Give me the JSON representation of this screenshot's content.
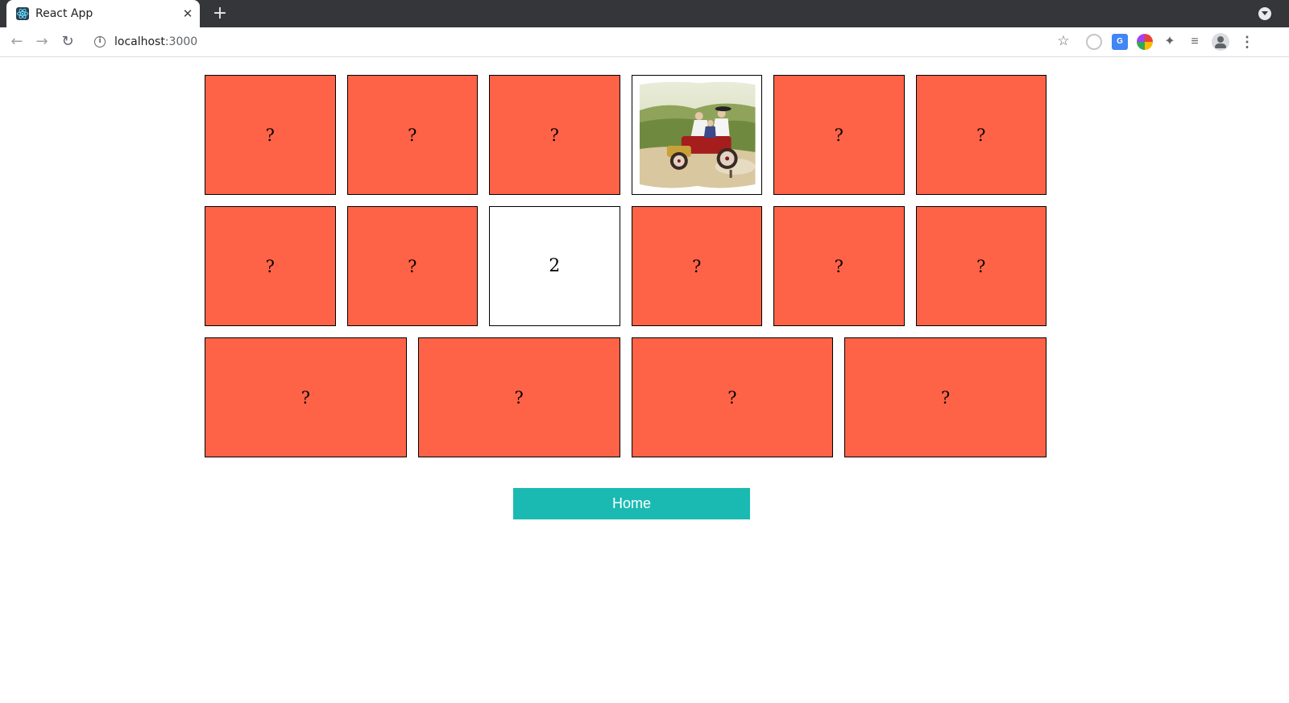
{
  "browser": {
    "tab_title": "React App",
    "tab_close": "✕",
    "new_tab": "+",
    "url_host": "localhost",
    "url_port": ":3000",
    "icons": [
      "react-favicon",
      "back-arrow-icon",
      "forward-arrow-icon",
      "reload-icon",
      "info-icon",
      "star-icon",
      "timer-extension-icon",
      "translate-extension-icon",
      "color-extension-icon",
      "puzzle-icon",
      "media-icon",
      "profile-icon",
      "menu-icon"
    ]
  },
  "board": {
    "hidden_symbol": "?",
    "card_color": "#ff6347",
    "rows": [
      [
        {
          "state": "hidden",
          "text": "?"
        },
        {
          "state": "hidden",
          "text": "?"
        },
        {
          "state": "hidden",
          "text": "?"
        },
        {
          "state": "image",
          "text": "",
          "image": "vintage car illustration"
        },
        {
          "state": "hidden",
          "text": "?"
        },
        {
          "state": "hidden",
          "text": "?"
        }
      ],
      [
        {
          "state": "hidden",
          "text": "?"
        },
        {
          "state": "hidden",
          "text": "?"
        },
        {
          "state": "text",
          "text": "2"
        },
        {
          "state": "hidden",
          "text": "?"
        },
        {
          "state": "hidden",
          "text": "?"
        },
        {
          "state": "hidden",
          "text": "?"
        }
      ],
      [
        {
          "state": "hidden",
          "text": "?"
        },
        {
          "state": "hidden",
          "text": "?"
        },
        {
          "state": "hidden",
          "text": "?"
        },
        {
          "state": "hidden",
          "text": "?"
        }
      ]
    ]
  },
  "home_button": {
    "label": "Home",
    "color": "#1abab2"
  }
}
